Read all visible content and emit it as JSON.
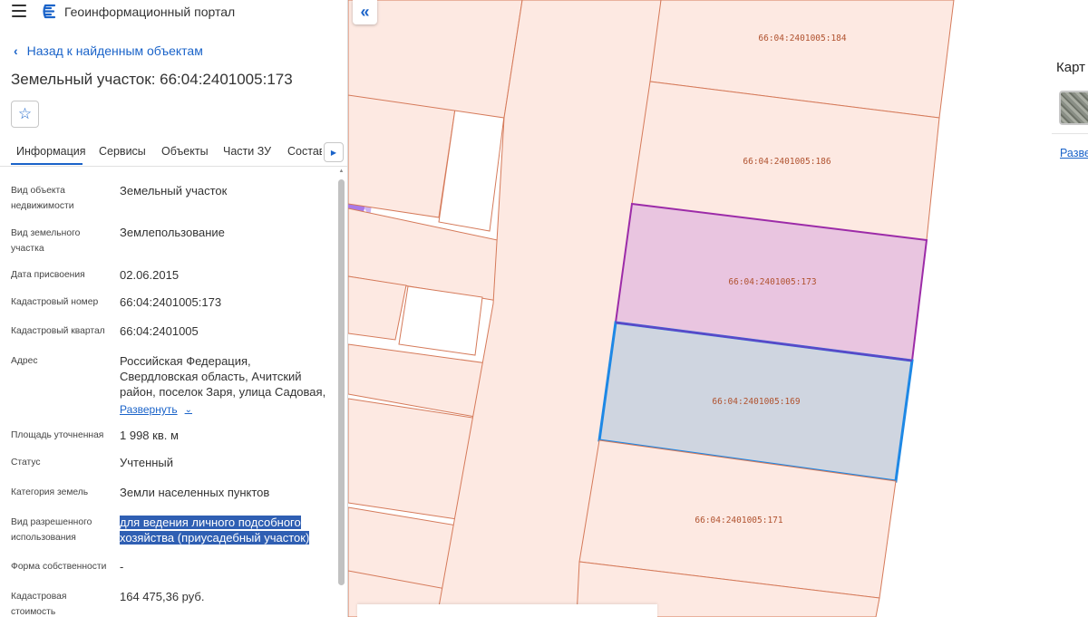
{
  "header": {
    "title": "Геоинформационный портал"
  },
  "back_link": "Назад к найденным объектам",
  "object_title": "Земельный участок: 66:04:2401005:173",
  "tabs": [
    "Информация",
    "Сервисы",
    "Объекты",
    "Части ЗУ",
    "Состав"
  ],
  "fields": {
    "kind_label_1": "Вид объекта",
    "kind_label_2": "недвижимости",
    "kind_value": "Земельный участок",
    "landtype_label_1": "Вид земельного",
    "landtype_label_2": "участка",
    "landtype_value": "Землепользование",
    "date_label": "Дата присвоения",
    "date_value": "02.06.2015",
    "cadnum_label": "Кадастровый номер",
    "cadnum_value": "66:04:2401005:173",
    "quarter_label": "Кадастровый квартал",
    "quarter_value": "66:04:2401005",
    "address_label": "Адрес",
    "address_line_1": "Российская Федерация,",
    "address_line_2": "Свердловская область, Ачитский",
    "address_line_3": "район, поселок Заря, улица Садовая,",
    "expand_label": "Развернуть",
    "area_label": "Площадь уточненная",
    "area_value": "1 998 кв. м",
    "status_label": "Статус",
    "status_value": "Учтенный",
    "category_label": "Категория земель",
    "category_value": "Земли населенных пунктов",
    "use_label_1": "Вид разрешенного",
    "use_label_2": "использования",
    "use_value_1": "для ведения личного подсобного",
    "use_value_2": "хозяйства (приусадебный участок)",
    "ownership_label": "Форма собственности",
    "ownership_value": "-",
    "cost_label_1": "Кадастровая",
    "cost_label_2": "стоимость",
    "cost_value": "164 475,36 руб."
  },
  "map": {
    "parcels": {
      "p184": "66:04:2401005:184",
      "p186": "66:04:2401005:186",
      "p173": "66:04:2401005:173",
      "p169": "66:04:2401005:169",
      "p171": "66:04:2401005:171"
    }
  },
  "right_panel": {
    "title": "Карт",
    "link": "Разверн"
  },
  "icons": {
    "menu": "hamburger-icon",
    "logo": "portal-logo-icon",
    "back": "chevron-left-icon",
    "favorite": "star-icon",
    "tabs_next": "triangle-right-icon",
    "collapse": "double-chevron-left-icon",
    "expand": "chevron-down-icon"
  },
  "colors": {
    "accent": "#1a63c9",
    "parcel_fill": "#fde9e2",
    "parcel_stroke": "#d57a5a",
    "selected_fill": "#e9c5e0",
    "selected_stroke": "#9c2ba8",
    "highlight_fill": "#cfd5e0",
    "highlight_stroke": "#1e88e5",
    "zone_purple": "#a97ae8"
  }
}
